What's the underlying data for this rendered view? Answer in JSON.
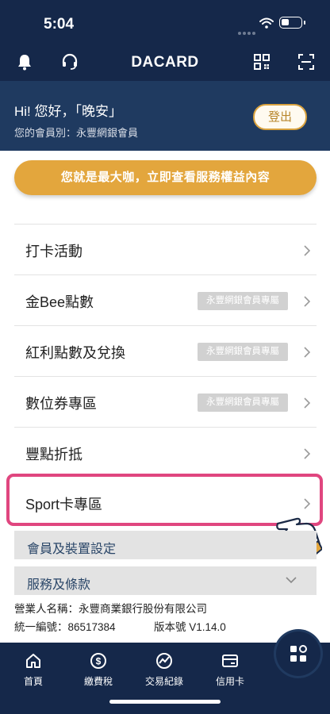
{
  "status_bar": {
    "time": "5:04"
  },
  "appbar": {
    "title": "DACARD"
  },
  "greeting": {
    "text": "Hi! 您好，「晚安」",
    "member_level": "您的會員別：永豐網銀會員",
    "logout_label": "登出"
  },
  "promo": {
    "label": "您就是最大咖，立即查看服務權益內容"
  },
  "menu": {
    "items": [
      {
        "label": "打卡活動",
        "tag": ""
      },
      {
        "label": "金Bee點數",
        "tag": "永豐網銀會員專屬"
      },
      {
        "label": "紅利點數及兌換",
        "tag": "永豐網銀會員專屬"
      },
      {
        "label": "數位券專區",
        "tag": "永豐網銀會員專屬"
      },
      {
        "label": "豐點折抵",
        "tag": ""
      },
      {
        "label": "Sport卡專區",
        "tag": ""
      }
    ]
  },
  "sections": {
    "member_settings": "會員及裝置設定",
    "terms": "服務及條款"
  },
  "footer_info": {
    "company": "營業人名稱：永豐商業銀行股份有限公司",
    "tax_id": "統一編號：86517384",
    "version": "版本號 V1.14.0"
  },
  "bottom_nav": {
    "items": [
      {
        "label": "首頁",
        "icon": "home-icon"
      },
      {
        "label": "繳費稅",
        "icon": "dollar-icon"
      },
      {
        "label": "交易紀錄",
        "icon": "chart-icon"
      },
      {
        "label": "信用卡",
        "icon": "credit-card-icon"
      }
    ]
  },
  "colors": {
    "navy": "#15284a",
    "panel": "#1f3a60",
    "gold": "#e3a63d",
    "highlight": "#e0467f"
  }
}
